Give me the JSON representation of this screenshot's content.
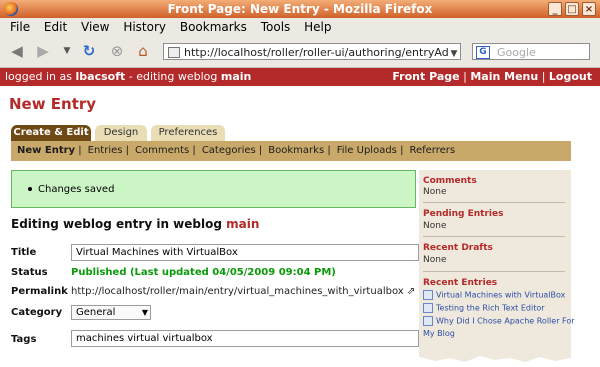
{
  "window": {
    "title": "Front Page: New Entry - Mozilla Firefox"
  },
  "menu": [
    "File",
    "Edit",
    "View",
    "History",
    "Bookmarks",
    "Tools",
    "Help"
  ],
  "toolbar": {
    "url": "http://localhost/roller/roller-ui/authoring/entryAd",
    "search_placeholder": "Google"
  },
  "adminbar": {
    "login_prefix": "logged in as ",
    "user": "lbacsoft",
    "editing_prefix": " - editing weblog ",
    "weblog": "main",
    "links": [
      "Front Page",
      "Main Menu",
      "Logout"
    ]
  },
  "page": {
    "title": "New Entry"
  },
  "tabs": [
    "Create & Edit",
    "Design",
    "Preferences"
  ],
  "subnav": [
    "New Entry",
    "Entries",
    "Comments",
    "Categories",
    "Bookmarks",
    "File Uploads",
    "Referrers"
  ],
  "message": "Changes saved",
  "heading": {
    "prefix": "Editing weblog entry in weblog ",
    "weblog": "main"
  },
  "form": {
    "title_label": "Title",
    "title_value": "Virtual Machines with VirtualBox",
    "status_label": "Status",
    "status_value": "Published (Last updated 04/05/2009 09:04 PM)",
    "permalink_label": "Permalink",
    "permalink_value": "http://localhost/roller/main/entry/virtual_machines_with_virtualbox",
    "category_label": "Category",
    "category_value": "General",
    "tags_label": "Tags",
    "tags_value": "machines virtual virtualbox"
  },
  "sidebar": {
    "comments_title": "Comments",
    "comments_value": "None",
    "pending_title": "Pending Entries",
    "pending_value": "None",
    "drafts_title": "Recent Drafts",
    "drafts_value": "None",
    "recent_title": "Recent Entries",
    "recent_entries": [
      "Virtual Machines with VirtualBox",
      "Testing the Rich Text Editor",
      "Why Did I Chose Apache Roller For"
    ],
    "recent_wrap": "My Blog"
  },
  "colors": {
    "accent": "#b42a2a",
    "tab_active": "#6f4a16",
    "subnav": "#c9a96a",
    "success": "#ccf5c6",
    "published": "#0a9a0a"
  }
}
